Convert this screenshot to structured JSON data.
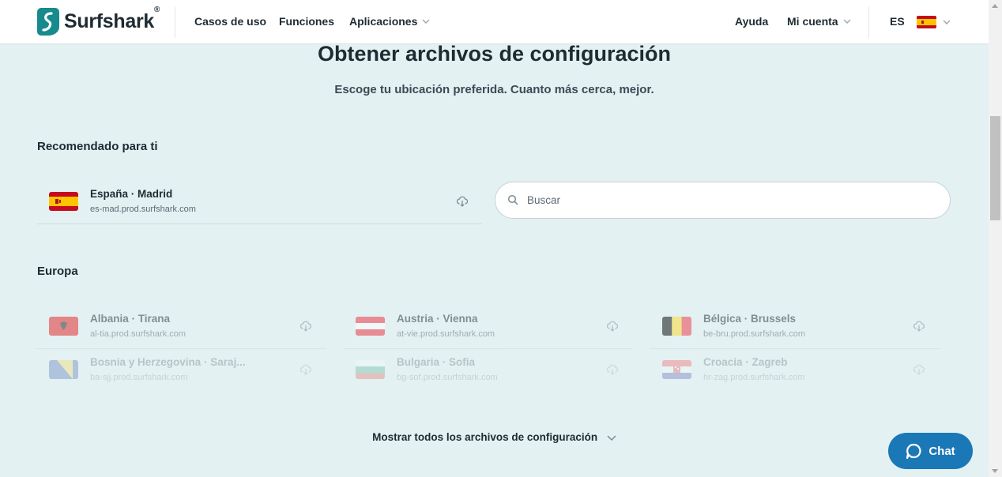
{
  "header": {
    "brand": "Surfshark",
    "brand_mark": "®",
    "nav": [
      {
        "label": "Casos de uso"
      },
      {
        "label": "Funciones"
      },
      {
        "label": "Aplicaciones"
      }
    ],
    "help": "Ayuda",
    "account": "Mi cuenta",
    "language": "ES"
  },
  "page": {
    "title": "Obtener archivos de configuración",
    "subtitle": "Escoge tu ubicación preferida. Cuanto más cerca, mejor."
  },
  "recommended": {
    "heading": "Recomendado para ti",
    "item": {
      "name": "España · Madrid",
      "host": "es-mad.prod.surfshark.com",
      "flag": "spain-flag"
    }
  },
  "search": {
    "placeholder": "Buscar",
    "value": ""
  },
  "europe": {
    "heading": "Europa",
    "items": [
      {
        "name": "Albania · Tirana",
        "host": "al-tia.prod.surfshark.com",
        "flag": "albania-flag"
      },
      {
        "name": "Austria · Vienna",
        "host": "at-vie.prod.surfshark.com",
        "flag": "austria-flag"
      },
      {
        "name": "Bélgica · Brussels",
        "host": "be-bru.prod.surfshark.com",
        "flag": "belgium-flag"
      },
      {
        "name": "Bosnia y Herzegovina · Saraj...",
        "host": "ba-sjj.prod.surfshark.com",
        "flag": "bosnia-flag"
      },
      {
        "name": "Bulgaria · Sofia",
        "host": "bg-sof.prod.surfshark.com",
        "flag": "bulgaria-flag"
      },
      {
        "name": "Croacia · Zagreb",
        "host": "hr-zag.prod.surfshark.com",
        "flag": "croatia-flag"
      }
    ]
  },
  "show_all": "Mostrar todos los archivos de configuración",
  "chat": {
    "label": "Chat"
  },
  "colors": {
    "background": "#e3f1f2",
    "brand_teal": "#178a8d",
    "chat_blue": "#1b78b7",
    "text_dark": "#1f2b33"
  }
}
